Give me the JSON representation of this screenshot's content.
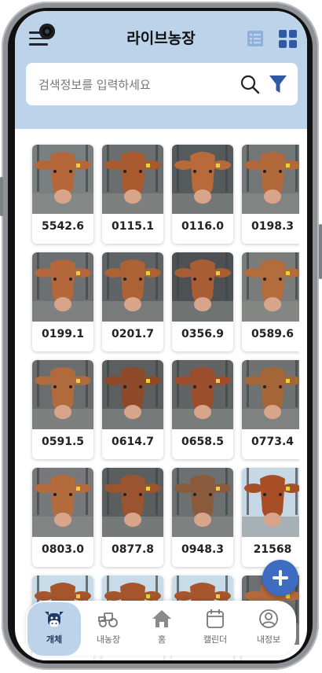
{
  "header": {
    "title": "라이브농장",
    "search_placeholder": "검색정보를 입력하세요",
    "accent_color": "#bdd3ea",
    "brand_color": "#3d6cc0"
  },
  "cattle": [
    {
      "tag": "5542.6",
      "coat": "#b5673a",
      "bg": "#7a7f80"
    },
    {
      "tag": "0115.1",
      "coat": "#a85a2e",
      "bg": "#6a6e70"
    },
    {
      "tag": "0116.0",
      "coat": "#b96a3a",
      "bg": "#555a5c"
    },
    {
      "tag": "0198.3",
      "coat": "#b1683a",
      "bg": "#737677"
    },
    {
      "tag": "0199.1",
      "coat": "#b3673b",
      "bg": "#6d7072"
    },
    {
      "tag": "0201.7",
      "coat": "#ad6236",
      "bg": "#5f6365"
    },
    {
      "tag": "0356.9",
      "coat": "#a95d35",
      "bg": "#4d5153"
    },
    {
      "tag": "0589.6",
      "coat": "#b56c3d",
      "bg": "#7a7c7b"
    },
    {
      "tag": "0591.5",
      "coat": "#b06a3c",
      "bg": "#6a6d6e"
    },
    {
      "tag": "0614.7",
      "coat": "#8e4a28",
      "bg": "#5c5f60"
    },
    {
      "tag": "0658.5",
      "coat": "#9c4e2c",
      "bg": "#606465"
    },
    {
      "tag": "0773.4",
      "coat": "#a56637",
      "bg": "#6f7273"
    },
    {
      "tag": "0803.0",
      "coat": "#b36a3d",
      "bg": "#767879"
    },
    {
      "tag": "0877.8",
      "coat": "#9a5530",
      "bg": "#5a5e5f"
    },
    {
      "tag": "0948.3",
      "coat": "#8a5a3c",
      "bg": "#6d7070"
    },
    {
      "tag": "21568",
      "coat": "#a84e26",
      "bg": "#c6d8e6"
    },
    {
      "tag": "",
      "coat": "#a6552c",
      "bg": "#c8dbe8"
    },
    {
      "tag": "",
      "coat": "#a6552c",
      "bg": "#c8dbe8"
    },
    {
      "tag": "",
      "coat": "#a6552c",
      "bg": "#c8dbe8"
    },
    {
      "tag": "",
      "coat": "#b36a3d",
      "bg": "#6d7070"
    }
  ],
  "nav": {
    "items": [
      {
        "label": "개체",
        "icon": "cow-icon",
        "active": true
      },
      {
        "label": "내농장",
        "icon": "tractor-icon",
        "active": false
      },
      {
        "label": "홈",
        "icon": "home-icon",
        "active": false
      },
      {
        "label": "캘린더",
        "icon": "calendar-icon",
        "active": false
      },
      {
        "label": "내정보",
        "icon": "profile-icon",
        "active": false
      }
    ]
  }
}
